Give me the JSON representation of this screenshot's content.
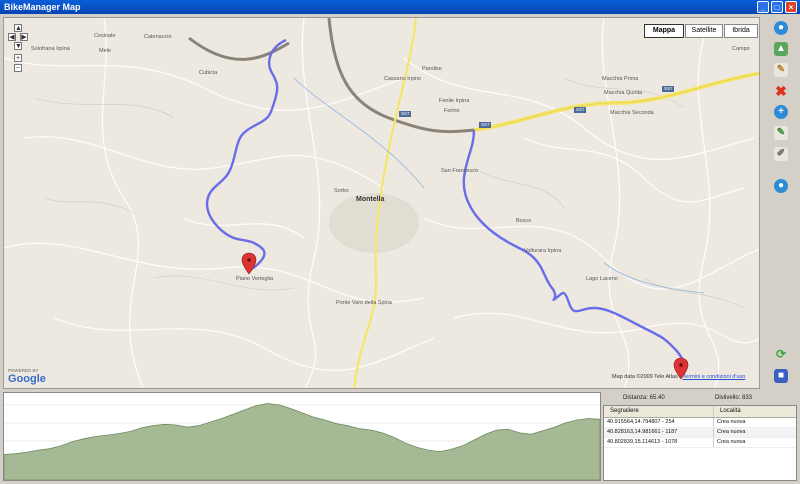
{
  "window": {
    "title": "BikeManager Map"
  },
  "map": {
    "types": [
      {
        "label": "Mappa",
        "active": true
      },
      {
        "label": "Satellite",
        "active": false
      },
      {
        "label": "Ibrida",
        "active": false
      }
    ],
    "places": [
      "Solofrana Irpina",
      "Cesinale",
      "Mele",
      "Catenaccio",
      "Cubicia",
      "Cassano Irpino",
      "Parolise",
      "Forino",
      "Fenile Irpina",
      "Montella",
      "Sorbo",
      "San Francesco",
      "Macchia Prima",
      "Macchia Quinta",
      "Macchia Seconda",
      "Campo",
      "Volturara Irpina",
      "Ponte Varo della Spina",
      "Bosco",
      "Lago Laceno",
      "Piano Verteglia"
    ],
    "roads": [
      "SS7",
      "SS7",
      "SS7",
      "SS7"
    ],
    "google_logo": "Google",
    "powered_by": "POWERED BY",
    "attribution": "Map data ©2009 Tele Atlas -",
    "terms_link": "Termini e condizioni d'uso",
    "route_color": "#6a6ce8",
    "highway_color": "#f5e66a"
  },
  "toolbar": [
    "globe-icon",
    "chart-icon",
    "brush-icon",
    "delete-icon",
    "globe-add-icon",
    "edit-icon",
    "edit-icon-2",
    "globe-icon-2",
    "refresh-icon",
    "save-icon"
  ],
  "stats": {
    "distance": "Distanza: 65.40",
    "elevation_gain": "Dislivello: 833"
  },
  "waypoints": {
    "columns": [
      "Segnaliere",
      "Località"
    ],
    "rows": [
      {
        "coord": "40.915564,14.794807 - 254",
        "place": "Crea nuova"
      },
      {
        "coord": "40.828163,14.981661 - 1187",
        "place": "Crea nuova"
      },
      {
        "coord": "40.802839,15.114613 - 1078",
        "place": "Crea nuova"
      }
    ]
  },
  "elevation_profile": {
    "fill_color": "#a5ba94",
    "line_color": "#6d8a5c",
    "elevations": [
      30,
      31,
      33,
      36,
      38,
      42,
      48,
      52,
      55,
      57,
      59,
      62,
      67,
      70,
      72,
      71,
      68,
      70,
      75,
      80,
      86,
      92,
      98,
      101,
      99,
      94,
      88,
      82,
      78,
      73,
      70,
      66,
      64,
      60,
      54,
      46,
      40,
      36,
      34,
      37,
      42,
      50,
      58,
      64,
      65,
      60,
      58,
      63,
      68,
      74,
      78,
      80,
      79
    ]
  }
}
